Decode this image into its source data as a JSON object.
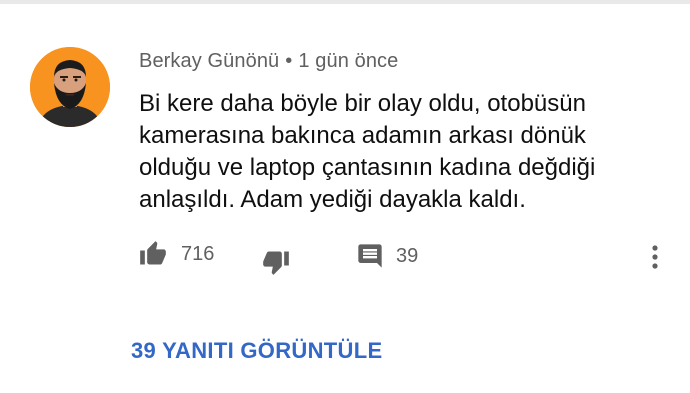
{
  "comment": {
    "author": "Berkay Günönü",
    "separator": "•",
    "timestamp": "1 gün önce",
    "text_lines": [
      "Bi kere daha böyle bir olay oldu, otobüsün",
      "kamerasına bakınca adamın arkası dönük",
      "olduğu ve laptop çantasının kadına değdiği",
      "anlaşıldı. Adam yediği dayakla kaldı."
    ]
  },
  "actions": {
    "like_count": "716",
    "reply_count": "39",
    "icons": [
      "thumb-up-icon",
      "thumb-down-icon",
      "comment-icon",
      "more-vert-icon"
    ]
  },
  "view_replies_label": "39 YANITI GÖRÜNTÜLE",
  "colors": {
    "secondary_text": "#606060",
    "primary_text": "#0f0f0f",
    "link_blue": "#3368c7",
    "avatar_bg": "#f7931e"
  }
}
